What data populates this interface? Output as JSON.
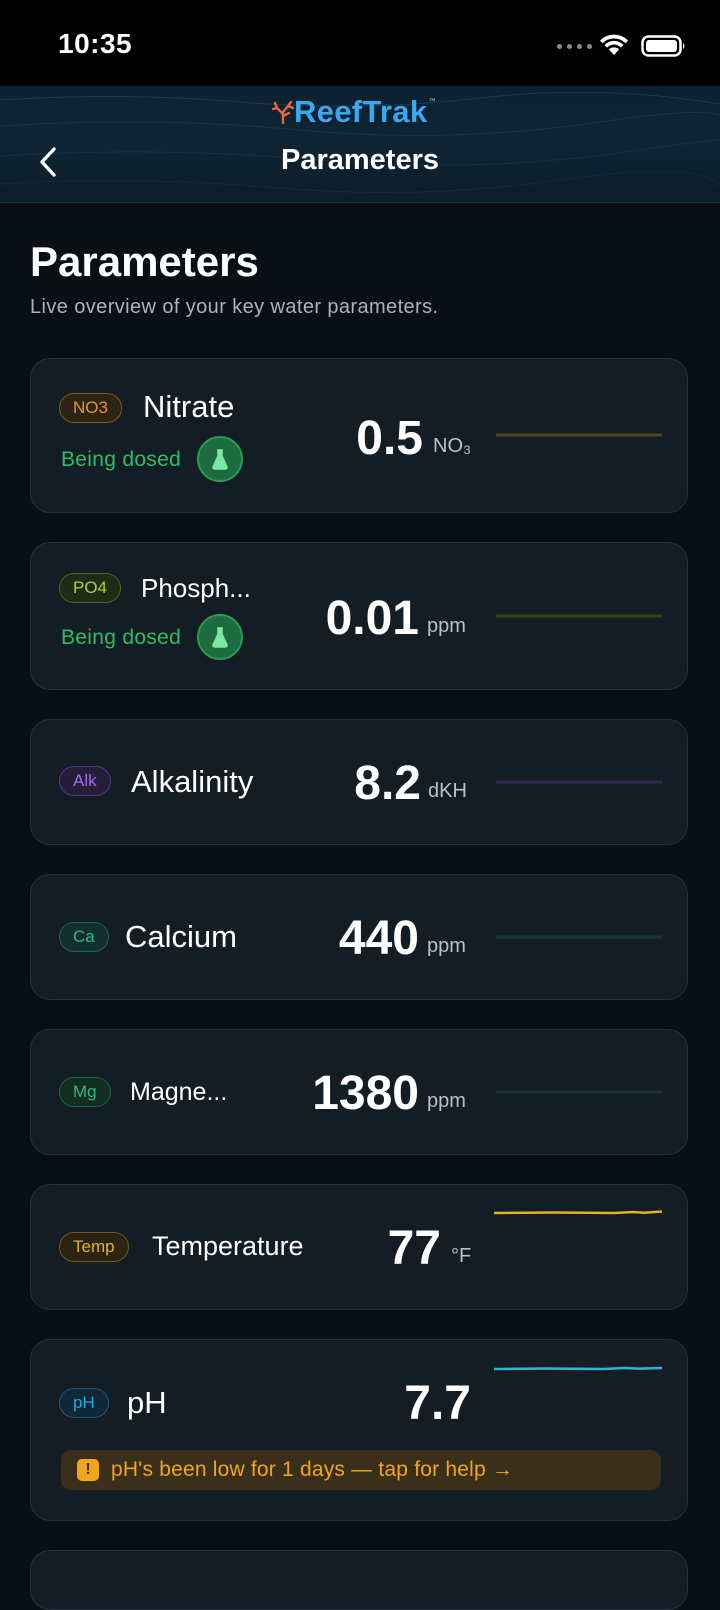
{
  "status": {
    "time": "10:35"
  },
  "header": {
    "logo": "ReefTrak",
    "logo_tm": "™",
    "title": "Parameters"
  },
  "page": {
    "title": "Parameters",
    "subtitle": "Live overview of your key water parameters."
  },
  "params": [
    {
      "tag": "NO3",
      "name": "Nitrate",
      "value": "0.5",
      "unit": "NO₃",
      "dosed": "Being dosed",
      "tag_color": "#e0962f",
      "line_color": "#5a4a1a"
    },
    {
      "tag": "PO4",
      "name": "Phosph...",
      "value": "0.01",
      "unit": "ppm",
      "dosed": "Being dosed",
      "tag_color": "#a8d33a",
      "line_color": "#3a4a1a"
    },
    {
      "tag": "Alk",
      "name": "Alkalinity",
      "value": "8.2",
      "unit": "dKH",
      "tag_color": "#a26df0",
      "line_color": "#3a2a5a"
    },
    {
      "tag": "Ca",
      "name": "Calcium",
      "value": "440",
      "unit": "ppm",
      "tag_color": "#2fb89a",
      "line_color": "#1a3a3a"
    },
    {
      "tag": "Mg",
      "name": "Magne...",
      "value": "1380",
      "unit": "ppm",
      "tag_color": "#2fb87a",
      "line_color": "#1a3a30"
    },
    {
      "tag": "Temp",
      "name": "Temperature",
      "value": "77",
      "unit": "°F",
      "tag_color": "#e3b12a",
      "line_color": "#e3b12a"
    },
    {
      "tag": "pH",
      "name": "pH",
      "value": "7.7",
      "unit": "",
      "tag_color": "#27a8d8",
      "line_color": "#27b8d8",
      "alert": "pH's been low for 1 days — tap for help →"
    }
  ]
}
